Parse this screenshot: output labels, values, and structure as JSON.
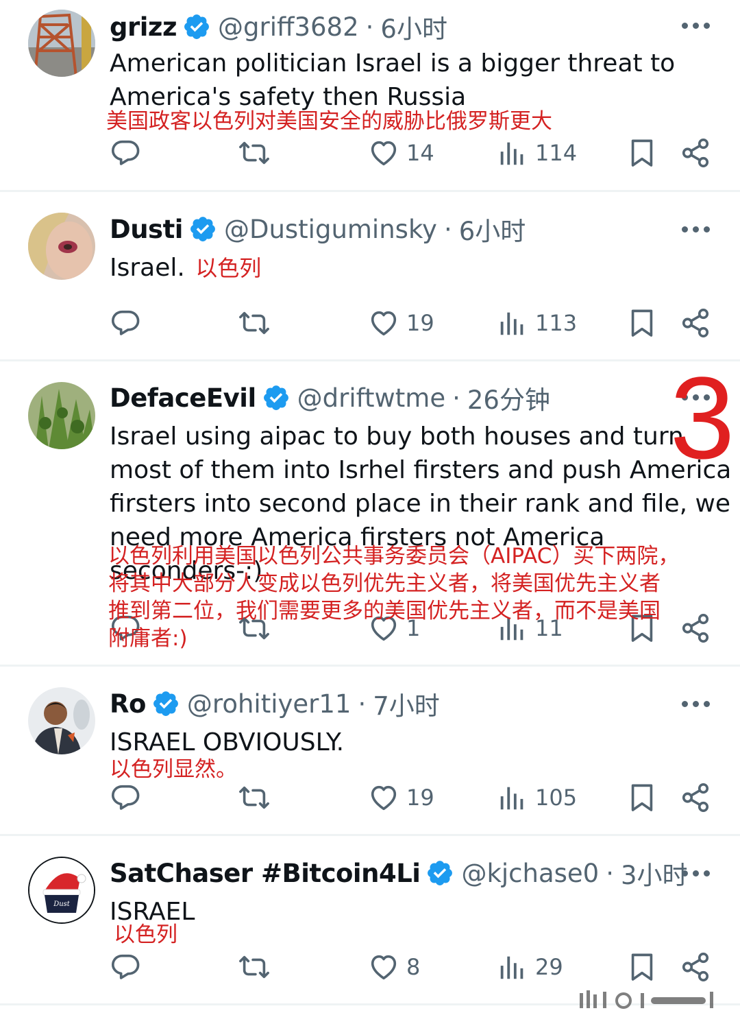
{
  "colors": {
    "text": "#0f1419",
    "secondary": "#536471",
    "verified": "#1d9bf0",
    "translation": "#d42222",
    "divider": "#eff3f4"
  },
  "annotation_number": "3",
  "tweets": [
    {
      "name": "grizz",
      "handle": "@griff3682",
      "time": "6小时",
      "text_lines": [
        "American politician Israel is a bigger threat to",
        "America's safety then Russia"
      ],
      "translation_lines": [
        "美国政客以色列对美国安全的威胁比俄罗斯更大"
      ],
      "likes": "14",
      "views": "114",
      "reposts": "",
      "replies": ""
    },
    {
      "name": "Dusti",
      "handle": "@Dustiguminsky",
      "time": "6小时",
      "text_lines": [
        "Israel."
      ],
      "translation_lines": [
        "以色列"
      ],
      "likes": "19",
      "views": "113",
      "reposts": "",
      "replies": ""
    },
    {
      "name": "DefaceEvil",
      "handle": "@driftwtme",
      "time": "26分钟",
      "text_lines": [
        "Israel using aipac to buy both houses and turn",
        "most of them into Isrhel firsters and push America",
        "firsters into second place in their rank and file, we",
        "need more America firsters not America",
        "seconders-:)"
      ],
      "translation_lines": [
        "以色列利用美国以色列公共事务委员会（AIPAC）买下两院，",
        "将其中大部分人变成以色列优先主义者，将美国优先主义者",
        "推到第二位，我们需要更多的美国优先主义者，而不是美国",
        "附庸者:)"
      ],
      "likes": "1",
      "views": "11",
      "reposts": "",
      "replies": ""
    },
    {
      "name": "Ro",
      "handle": "@rohitiyer11",
      "time": "7小时",
      "text_lines": [
        "ISRAEL OBVIOUSLY."
      ],
      "translation_lines": [
        "以色列显然。"
      ],
      "likes": "19",
      "views": "105",
      "reposts": "",
      "replies": ""
    },
    {
      "name": "SatChaser #Bitcoin4Li",
      "handle": "@kjchase0",
      "time": "3小时",
      "text_lines": [
        "ISRAEL"
      ],
      "translation_lines": [
        "以色列"
      ],
      "likes": "8",
      "views": "29",
      "reposts": "",
      "replies": ""
    }
  ]
}
